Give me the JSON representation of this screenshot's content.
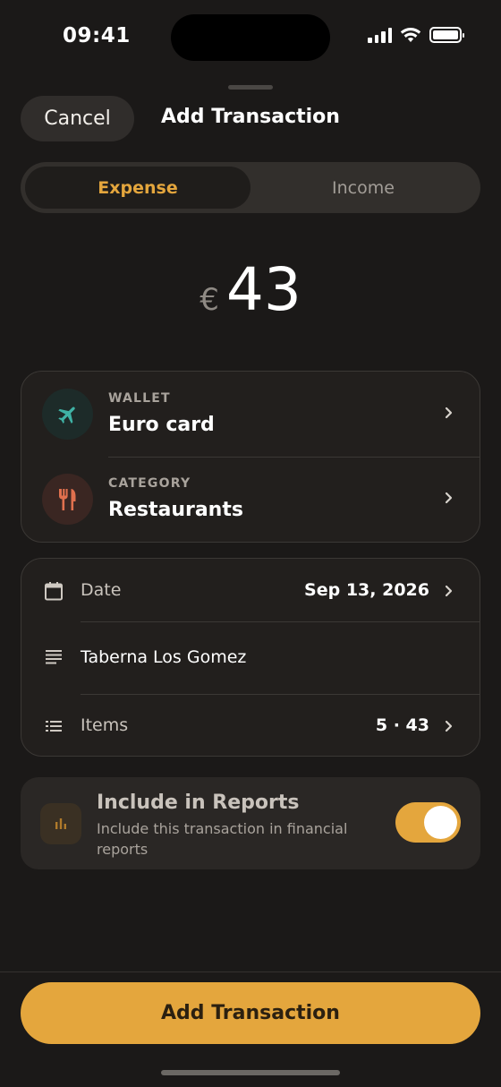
{
  "status_bar": {
    "time": "09:41"
  },
  "header": {
    "cancel_label": "Cancel",
    "title": "Add Transaction"
  },
  "segmented": {
    "expense_label": "Expense",
    "income_label": "Income",
    "selected": "Expense"
  },
  "amount": {
    "currency_symbol": "€",
    "value": "43"
  },
  "wallet": {
    "label": "WALLET",
    "value": "Euro card",
    "icon": "airplane-icon",
    "color": "#3fb2a5"
  },
  "category": {
    "label": "CATEGORY",
    "value": "Restaurants",
    "icon": "fork-knife-icon",
    "color": "#e0704e"
  },
  "details": {
    "date_label": "Date",
    "date_value": "Sep 13, 2026",
    "note": "Taberna Los Gomez",
    "items_label": "Items",
    "items_value": "5 · 43"
  },
  "reports": {
    "title": "Include in Reports",
    "subtitle": "Include this transaction in financial reports",
    "enabled": true,
    "icon": "bar-chart-icon"
  },
  "cta": {
    "label": "Add Transaction"
  },
  "colors": {
    "accent": "#e4a63d",
    "background": "#1b1918",
    "card": "#221f1d"
  }
}
